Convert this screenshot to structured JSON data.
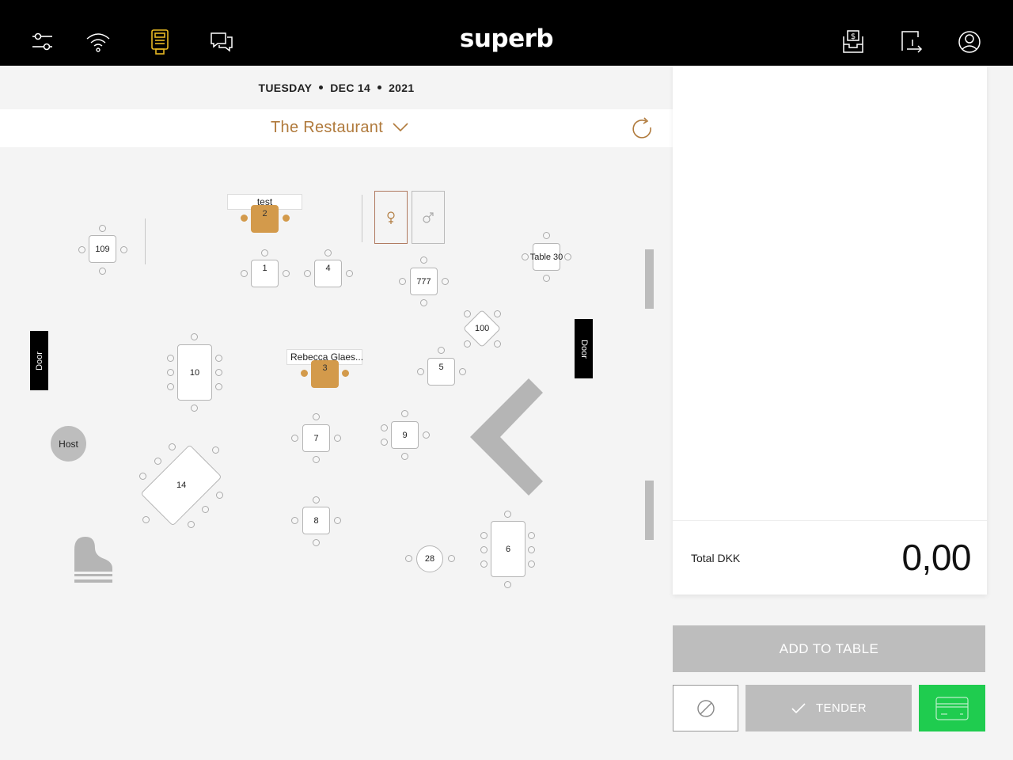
{
  "app": {
    "brand": "superb",
    "toolbar_left": [
      "settings-sliders-icon",
      "wifi-icon",
      "card-terminal-icon",
      "chat-icon"
    ],
    "toolbar_right": [
      "cash-drawer-icon",
      "logout-icon",
      "user-profile-icon"
    ],
    "accent_color": "#b07a3c",
    "active_icon_color": "#e8b923"
  },
  "date": {
    "weekday": "TUESDAY",
    "day": "DEC 14",
    "year": "2021"
  },
  "room": {
    "name": "The Restaurant"
  },
  "floor": {
    "tables": [
      {
        "label": "109"
      },
      {
        "label": "2",
        "reservation": "test",
        "occupied": true
      },
      {
        "label": "1"
      },
      {
        "label": "4"
      },
      {
        "label": "777"
      },
      {
        "label": "Table 30"
      },
      {
        "label": "100"
      },
      {
        "label": "10"
      },
      {
        "label": "3",
        "reservation": "Rebecca Glaes...",
        "occupied": true
      },
      {
        "label": "5"
      },
      {
        "label": "7"
      },
      {
        "label": "9"
      },
      {
        "label": "14"
      },
      {
        "label": "8"
      },
      {
        "label": "28"
      },
      {
        "label": "6"
      }
    ],
    "doors": [
      "Door",
      "Door"
    ],
    "host": "Host",
    "restrooms": [
      "female-restroom-icon",
      "male-restroom-icon"
    ],
    "decor": [
      "piano-icon"
    ]
  },
  "order": {
    "total_label": "Total DKK",
    "total_value": "0,00"
  },
  "actions": {
    "add_to_table": "ADD TO TABLE",
    "tender": "TENDER",
    "void_icon": "void-icon",
    "card_icon": "card-payment-icon",
    "card_color": "#1fcc4f"
  }
}
